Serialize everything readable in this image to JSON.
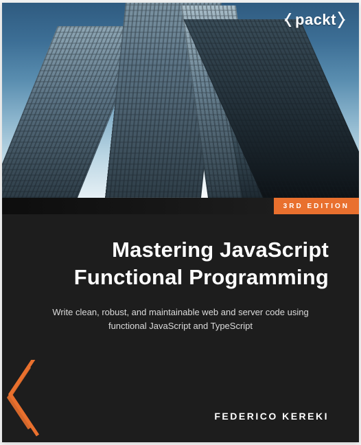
{
  "publisher": "packt",
  "edition_badge": "3RD EDITION",
  "title_line1": "Mastering JavaScript",
  "title_line2": "Functional Programming",
  "subtitle": "Write clean, robust, and maintainable web and server code using functional JavaScript and TypeScript",
  "author": "FEDERICO KEREKI",
  "colors": {
    "accent": "#e9702e",
    "background": "#1d1d1d"
  }
}
